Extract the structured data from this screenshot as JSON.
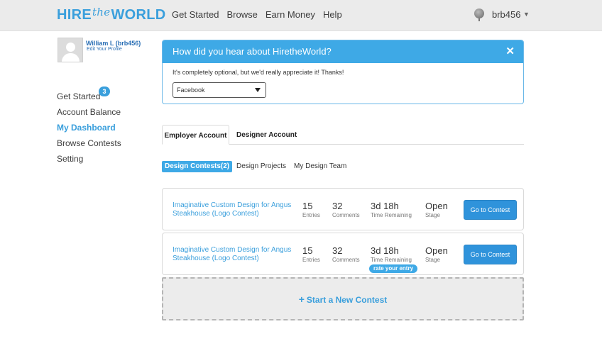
{
  "header": {
    "logo_left": "HIRE",
    "logo_mid": "the",
    "logo_right": "WORLD",
    "nav": [
      "Get Started",
      "Browse",
      "Earn Money",
      "Help"
    ],
    "username": "brb456",
    "caret": "▼"
  },
  "sidebar": {
    "user_name": "William L (brb456)",
    "edit_profile": "Edit Your Profile",
    "badge": "3",
    "items": [
      {
        "label": "Get Started"
      },
      {
        "label": "Account Balance"
      },
      {
        "label": "My Dashboard"
      },
      {
        "label": "Browse Contests"
      },
      {
        "label": "Setting"
      }
    ]
  },
  "survey": {
    "title": "How did you hear about HiretheWorld?",
    "close": "✕",
    "text": "It's completely optional, but we'd really appreciate it! Thanks!",
    "selected": "Facebook"
  },
  "account_tabs": [
    "Employer Account",
    "Designer Account"
  ],
  "sub_tabs": [
    "Design Contests(2)",
    "Design Projects",
    "My Design Team"
  ],
  "contests": [
    {
      "title": "Imaginative Custom Design for Angus Steakhouse (Logo Contest)",
      "entries": "15",
      "entries_label": "Entries",
      "comments": "32",
      "comments_label": "Comments",
      "time": "3d 18h",
      "time_label": "Time Remaining",
      "stage": "Open",
      "stage_label": "Stage",
      "button": "Go to Contest"
    },
    {
      "title": "Imaginative Custom Design for Angus Steakhouse (Logo Contest)",
      "entries": "15",
      "entries_label": "Entries",
      "comments": "32",
      "comments_label": "Comments",
      "time": "3d 18h",
      "time_label": "Time Remaining",
      "stage": "Open",
      "stage_label": "Stage",
      "button": "Go to Contest",
      "rate": "rate your entry"
    }
  ],
  "new_contest": {
    "plus": "+",
    "label": "Start a New Contest"
  },
  "colors": {
    "accent": "#3a9fdc",
    "header_bg": "#ebebeb",
    "button": "#2f93db"
  }
}
